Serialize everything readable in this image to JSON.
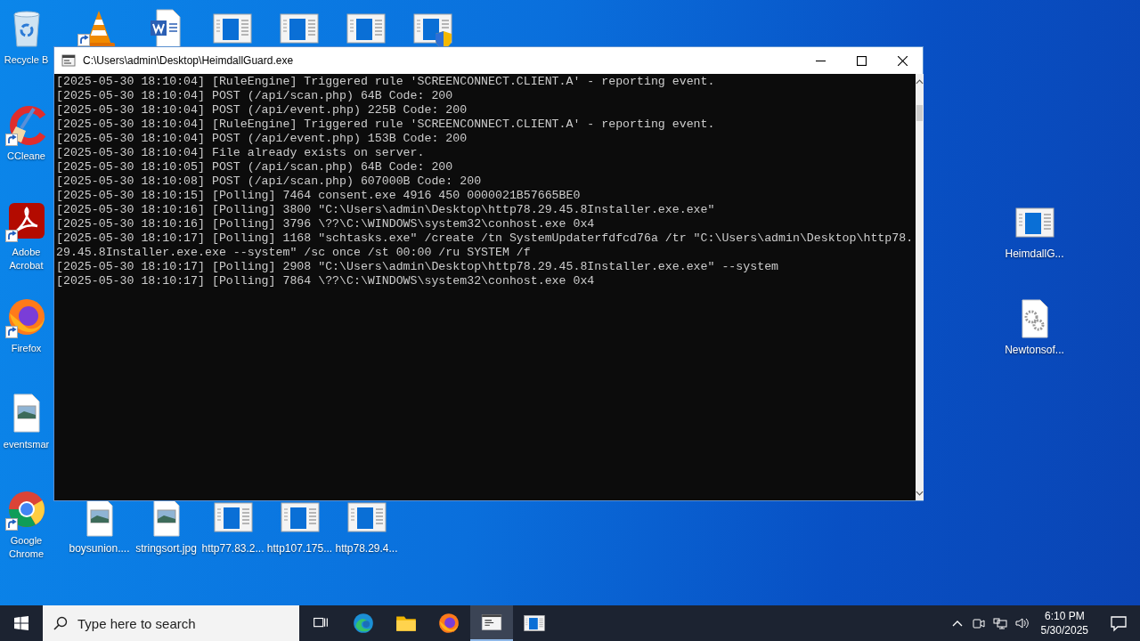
{
  "desktop": {
    "left_icons": [
      {
        "kind": "recycle",
        "label": "Recycle B",
        "shortcut": false
      },
      {
        "kind": "ccleaner",
        "label": "CCleane",
        "shortcut": true
      },
      {
        "kind": "acrobat",
        "label": "Adobe Acrobat",
        "shortcut": true
      },
      {
        "kind": "firefox",
        "label": "Firefox",
        "shortcut": true
      },
      {
        "kind": "image",
        "label": "eventsmar",
        "shortcut": false
      },
      {
        "kind": "chrome",
        "label": "Google Chrome",
        "shortcut": true
      }
    ],
    "top_icons": [
      {
        "kind": "vlc",
        "shortcut": true
      },
      {
        "kind": "word",
        "shortcut": false
      },
      {
        "kind": "app",
        "shortcut": false
      },
      {
        "kind": "app",
        "shortcut": false
      },
      {
        "kind": "app",
        "shortcut": false
      },
      {
        "kind": "app-shield",
        "shortcut": false
      }
    ],
    "bottom_icons": [
      {
        "kind": "image",
        "label": "boysunion....",
        "shortcut": false
      },
      {
        "kind": "image",
        "label": "stringsort.jpg",
        "shortcut": false
      },
      {
        "kind": "app",
        "label": "http77.83.2...",
        "shortcut": false
      },
      {
        "kind": "app",
        "label": "http107.175...",
        "shortcut": false
      },
      {
        "kind": "app",
        "label": "http78.29.4...",
        "shortcut": false
      }
    ],
    "right_icons": [
      {
        "kind": "app",
        "label": "HeimdallG...",
        "shortcut": false
      },
      {
        "kind": "gear-file",
        "label": "Newtonsof...",
        "shortcut": false
      }
    ]
  },
  "window": {
    "title": "C:\\Users\\admin\\Desktop\\HeimdallGuard.exe",
    "console_lines": [
      "[2025-05-30 18:10:04] [RuleEngine] Triggered rule 'SCREENCONNECT.CLIENT.A' - reporting event.",
      "[2025-05-30 18:10:04] POST (/api/scan.php) 64B Code: 200",
      "[2025-05-30 18:10:04] POST (/api/event.php) 225B Code: 200",
      "[2025-05-30 18:10:04] [RuleEngine] Triggered rule 'SCREENCONNECT.CLIENT.A' - reporting event.",
      "[2025-05-30 18:10:04] POST (/api/event.php) 153B Code: 200",
      "[2025-05-30 18:10:04] File already exists on server.",
      "[2025-05-30 18:10:05] POST (/api/scan.php) 64B Code: 200",
      "[2025-05-30 18:10:08] POST (/api/scan.php) 607000B Code: 200",
      "[2025-05-30 18:10:15] [Polling] 7464 consent.exe 4916 450 0000021B57665BE0",
      "[2025-05-30 18:10:16] [Polling] 3800 \"C:\\Users\\admin\\Desktop\\http78.29.45.8Installer.exe.exe\"",
      "[2025-05-30 18:10:16] [Polling] 3796 \\??\\C:\\WINDOWS\\system32\\conhost.exe 0x4",
      "[2025-05-30 18:10:17] [Polling] 1168 \"schtasks.exe\" /create /tn SystemUpdaterfdfcd76a /tr \"C:\\Users\\admin\\Desktop\\http78.29.45.8Installer.exe.exe --system\" /sc once /st 00:00 /ru SYSTEM /f",
      "[2025-05-30 18:10:17] [Polling] 2908 \"C:\\Users\\admin\\Desktop\\http78.29.45.8Installer.exe.exe\" --system",
      "[2025-05-30 18:10:17] [Polling] 7864 \\??\\C:\\WINDOWS\\system32\\conhost.exe 0x4"
    ]
  },
  "taskbar": {
    "search": {
      "placeholder": "Type here to search"
    },
    "apps": [
      {
        "kind": "taskview",
        "selected": false
      },
      {
        "kind": "edge",
        "selected": false
      },
      {
        "kind": "explorer",
        "selected": false
      },
      {
        "kind": "firefox",
        "selected": false
      },
      {
        "kind": "console",
        "selected": true
      },
      {
        "kind": "app",
        "selected": false
      }
    ],
    "clock": {
      "time": "6:10 PM",
      "date": "5/30/2025"
    }
  }
}
